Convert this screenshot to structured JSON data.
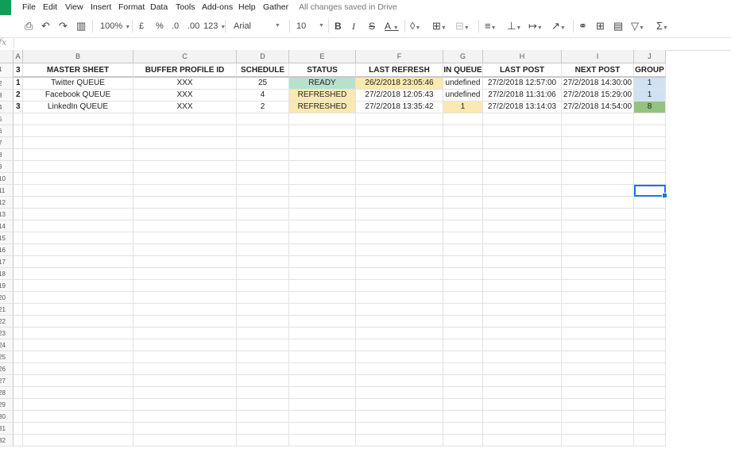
{
  "menu": {
    "items": [
      "File",
      "Edit",
      "View",
      "Insert",
      "Format",
      "Data",
      "Tools",
      "Add-ons",
      "Help",
      "Gather"
    ],
    "saved_status": "All changes saved in Drive"
  },
  "toolbar": {
    "zoom": "100%",
    "currency": "£",
    "percent": "%",
    "decrease_decimals": ".0",
    "increase_decimals": ".00",
    "more_formats": "123",
    "font": "Arial",
    "font_size": "10",
    "bold": "B",
    "italic": "I",
    "strike": "S",
    "text_color": "A",
    "functions": "Σ"
  },
  "formula_bar": {
    "fx": "fx"
  },
  "sheet": {
    "columns": [
      "A",
      "B",
      "C",
      "D",
      "E",
      "F",
      "G",
      "H",
      "I",
      "J"
    ],
    "rows": [
      "1",
      "2",
      "3",
      "4",
      "5",
      "6",
      "7",
      "8",
      "9",
      "10",
      "11",
      "12",
      "13",
      "14",
      "15",
      "16",
      "17",
      "18",
      "19",
      "20",
      "21",
      "22",
      "23",
      "24",
      "25",
      "26",
      "27",
      "28",
      "29",
      "30",
      "31",
      "32"
    ],
    "header_row": [
      "3",
      "MASTER SHEET",
      "BUFFER PROFILE ID",
      "SCHEDULE",
      "STATUS",
      "LAST REFRESH",
      "IN QUEUE",
      "LAST POST",
      "NEXT POST",
      "GROUP"
    ],
    "data_rows": [
      [
        "1",
        "Twitter QUEUE",
        "XXX",
        "25",
        "READY",
        "26/2/2018 23:05:46",
        "undefined",
        "27/2/2018 12:57:00",
        "27/2/2018 14:30:00",
        "1"
      ],
      [
        "2",
        "Facebook QUEUE",
        "XXX",
        "4",
        "REFRESHED",
        "27/2/2018 12:05:43",
        "undefined",
        "27/2/2018 11:31:06",
        "27/2/2018 15:29:00",
        "1"
      ],
      [
        "3",
        "LinkedIn QUEUE",
        "XXX",
        "2",
        "REFRESHED",
        "27/2/2018 13:35:42",
        "1",
        "27/2/2018 13:14:03",
        "27/2/2018 14:54:00",
        "8"
      ]
    ],
    "cell_colors": {
      "ready": "#b7e1cd",
      "refreshed": "#fce8b2",
      "group_blue": "#cfe2f3",
      "group_green": "#93c47d",
      "selection": "#1a73e8"
    }
  }
}
